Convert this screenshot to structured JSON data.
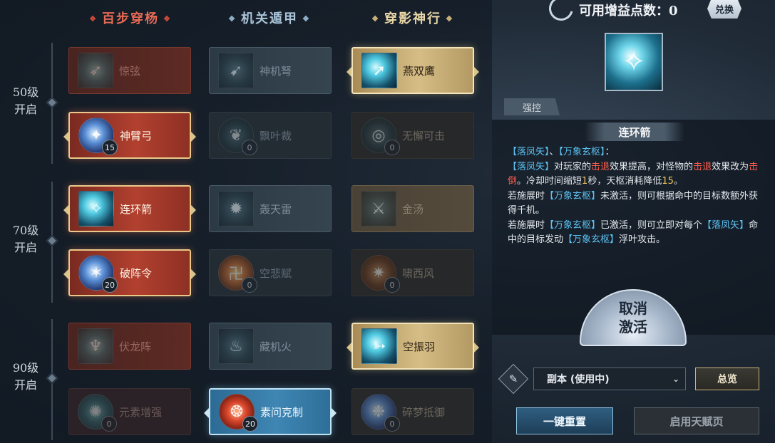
{
  "columns": [
    {
      "title": "百步穿杨"
    },
    {
      "title": "机关遁甲"
    },
    {
      "title": "穿影神行"
    }
  ],
  "tiers": [
    {
      "level": "50级",
      "unlock": "开启"
    },
    {
      "level": "70级",
      "unlock": "开启"
    },
    {
      "level": "90级",
      "unlock": "开启"
    }
  ],
  "skills": {
    "r1c1": {
      "name": "惊弦"
    },
    "r2c1": {
      "name": "神臂弓",
      "count": "15"
    },
    "r3c1": {
      "name": "连环箭"
    },
    "r4c1": {
      "name": "破阵令",
      "count": "20"
    },
    "r5c1": {
      "name": "伏龙阵"
    },
    "r6c1": {
      "name": "元素增强",
      "count": "0"
    },
    "r1c2": {
      "name": "神机弩"
    },
    "r2c2": {
      "name": "飘叶裁",
      "count": "0"
    },
    "r3c2": {
      "name": "轰天雷"
    },
    "r4c2": {
      "name": "空悲赋",
      "count": "0"
    },
    "r5c2": {
      "name": "藏机火"
    },
    "r6c2": {
      "name": "素问克制",
      "count": "20"
    },
    "r1c3": {
      "name": "燕双鹰"
    },
    "r2c3": {
      "name": "无懈可击",
      "count": "0"
    },
    "r3c3": {
      "name": "金汤"
    },
    "r4c3": {
      "name": "啸西风",
      "count": "0"
    },
    "r5c3": {
      "name": "空振羽"
    },
    "r6c3": {
      "name": "碎梦抵御",
      "count": "0"
    }
  },
  "points": {
    "label": "可用增益点数：",
    "value": "0",
    "exchange": "兑换"
  },
  "detail": {
    "tag": "强控",
    "title": "连环箭",
    "lines": {
      "l1a": "【落凤矢】",
      "l1b": "、",
      "l1c": "【万象玄枢】",
      "l1d": "：",
      "l2a": "【落凤矢】",
      "l2b": "对玩家的",
      "l2c": "击退",
      "l2d": "效果提高，对怪物的",
      "l2e": "击退",
      "l2f": "效果改为",
      "l2g": "击倒",
      "l2h": "。冷却时间缩短",
      "l2i": "1",
      "l2j": "秒，天枢消耗降低",
      "l2k": "15",
      "l2l": "。",
      "l3a": "若施展时",
      "l3b": "【万象玄枢】",
      "l3c": "未激活，则可根据命中的目标数额外获得千机。",
      "l4a": "若施展时",
      "l4b": "【万象玄枢】",
      "l4c": "已激活，则可立即对每个",
      "l4d": "【落凤矢】",
      "l4e": "命中的目标发动",
      "l4f": "【万象玄枢】",
      "l4g": "浮叶攻击。"
    }
  },
  "cancel": {
    "line1": "取消",
    "line2": "激活"
  },
  "plan": {
    "selected": "副本 (使用中)",
    "overview": "总览"
  },
  "buttons": {
    "reset": "一键重置",
    "enable": "启用天赋页"
  }
}
